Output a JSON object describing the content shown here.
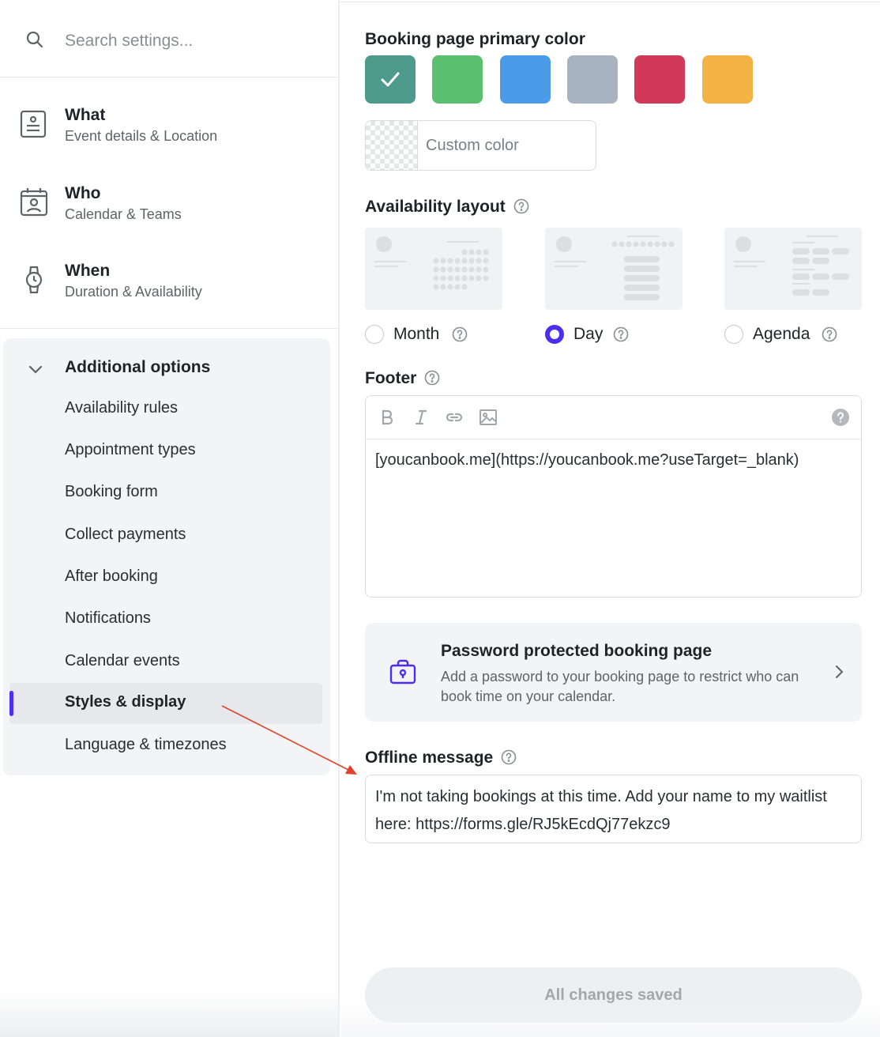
{
  "search": {
    "placeholder": "Search settings..."
  },
  "nav": [
    {
      "title": "What",
      "subtitle": "Event details & Location",
      "icon": "event-details-icon"
    },
    {
      "title": "Who",
      "subtitle": "Calendar & Teams",
      "icon": "calendar-person-icon"
    },
    {
      "title": "When",
      "subtitle": "Duration & Availability",
      "icon": "watch-icon"
    }
  ],
  "additional": {
    "label": "Additional options",
    "items": [
      "Availability rules",
      "Appointment types",
      "Booking form",
      "Collect payments",
      "After booking",
      "Notifications",
      "Calendar events",
      "Styles & display",
      "Language & timezones"
    ],
    "active": "Styles & display"
  },
  "main": {
    "primary_color_label": "Booking page primary color",
    "swatches": [
      "#4e9a8c",
      "#5bbf70",
      "#4a9ce8",
      "#a7b3c0",
      "#d2385a",
      "#f4b144"
    ],
    "selected_swatch": "#4e9a8c",
    "custom_color_label": "Custom color",
    "availability_label": "Availability layout",
    "layouts": [
      {
        "label": "Month",
        "selected": false
      },
      {
        "label": "Day",
        "selected": true
      },
      {
        "label": "Agenda",
        "selected": false
      }
    ],
    "footer_label": "Footer",
    "footer_text": "[youcanbook.me](https://youcanbook.me?useTarget=_blank)",
    "password": {
      "title": "Password protected booking page",
      "description": "Add a password to your booking page to restrict who can book time on your calendar."
    },
    "offline_label": "Offline message",
    "offline_text": "I'm not taking bookings at this time. Add your name to my waitlist here: https://forms.gle/RJ5kEcdQj77ekzc9",
    "save_status": "All changes saved"
  },
  "colors": {
    "accent": "#4a2ff0",
    "annotation_arrow": "#e0432b"
  }
}
